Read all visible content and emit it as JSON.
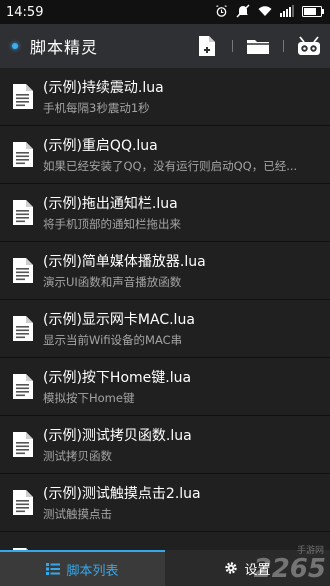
{
  "status": {
    "time": "14:59"
  },
  "app": {
    "title": "脚本精灵",
    "accent": "#3ab0f2"
  },
  "toolbar": {
    "icons": [
      "add-file-icon",
      "folder-icon",
      "robot-icon"
    ]
  },
  "scripts": [
    {
      "title": "(示例)持续震动.lua",
      "desc": "手机每隔3秒震动1秒"
    },
    {
      "title": "(示例)重启QQ.lua",
      "desc": "如果已经安装了QQ，没有运行则启动QQ，已经..."
    },
    {
      "title": "(示例)拖出通知栏.lua",
      "desc": "将手机顶部的通知栏拖出来"
    },
    {
      "title": "(示例)简单媒体播放器.lua",
      "desc": "演示UI函数和声音播放函数"
    },
    {
      "title": "(示例)显示网卡MAC.lua",
      "desc": "显示当前Wifi设备的MAC串"
    },
    {
      "title": "(示例)按下Home键.lua",
      "desc": "模拟按下Home键"
    },
    {
      "title": "(示例)测试拷贝函数.lua",
      "desc": "测试拷贝函数"
    },
    {
      "title": "(示例)测试触摸点击2.lua",
      "desc": "测试触摸点击"
    },
    {
      "title": "(示例)测试触摸点击.lua",
      "desc": ""
    }
  ],
  "tabs": {
    "list_label": "脚本列表",
    "settings_label": "设置"
  },
  "watermark": {
    "main": "2265",
    "sub": "手游网"
  }
}
